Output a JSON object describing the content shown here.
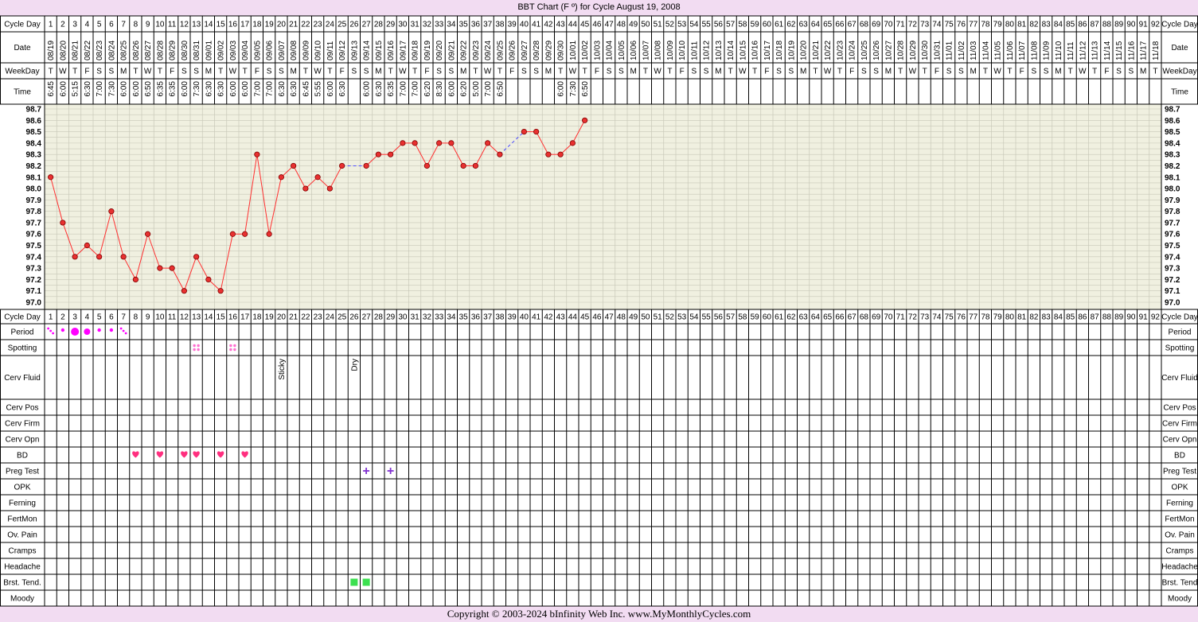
{
  "header": {
    "title": "BBT Chart (F º) for Cycle August 19, 2008"
  },
  "footer": {
    "copyright": "Copyright © 2003-2024 bInfinity Web Inc.     www.MyMonthlyCycles.com"
  },
  "row_labels": {
    "cycle_day": "Cycle Day",
    "date": "Date",
    "weekday": "WeekDay",
    "time": "Time",
    "period": "Period",
    "spotting": "Spotting",
    "cerv_fluid": "Cerv Fluid",
    "cerv_pos": "Cerv Pos",
    "cerv_firm": "Cerv Firm",
    "cerv_opn": "Cerv Opn",
    "bd": "BD",
    "preg_test": "Preg Test",
    "opk": "OPK",
    "ferning": "Ferning",
    "fertmon": "FertMon",
    "ov_pain": "Ov. Pain",
    "cramps": "Cramps",
    "headache": "Headache",
    "brst_tend_left": "Brst. Tend.",
    "brst_tend_right": "Brst. Tend",
    "moody": "Moody"
  },
  "colors": {
    "background": "#f2dcf2",
    "plot_background": "#f0f0e0",
    "grid": "#c8c8b8",
    "line": "#ff3030",
    "marker_fill": "#e83030",
    "dashed": "#5050ff",
    "period": "#ff00ff",
    "spotting": "#ff6fd0",
    "heart": "#ff2f7f",
    "preg_test": "#8030d0",
    "brst_tend": "#3ce050"
  },
  "chart_data": {
    "type": "line",
    "title": "BBT Chart (F º) for Cycle August 19, 2008",
    "ylim": [
      97.0,
      98.7
    ],
    "y_ticks": [
      "98.7",
      "98.6",
      "98.5",
      "98.4",
      "98.3",
      "98.2",
      "98.1",
      "98.0",
      "97.9",
      "97.8",
      "97.7",
      "97.6",
      "97.5",
      "97.4",
      "97.3",
      "97.2",
      "97.1",
      "97.0"
    ],
    "grid": true,
    "cycle_days": [
      1,
      2,
      3,
      4,
      5,
      6,
      7,
      8,
      9,
      10,
      11,
      12,
      13,
      14,
      15,
      16,
      17,
      18,
      19,
      20,
      21,
      22,
      23,
      24,
      25,
      26,
      27,
      28,
      29,
      30,
      31,
      32,
      33,
      34,
      35,
      36,
      37,
      38,
      39,
      40,
      41,
      42,
      43,
      44,
      45,
      46,
      47,
      48,
      49,
      50,
      51,
      52,
      53,
      54,
      55,
      56,
      57,
      58,
      59,
      60,
      61,
      62,
      63,
      64,
      65,
      66,
      67,
      68,
      69,
      70,
      71,
      72,
      73,
      74,
      75,
      76,
      77,
      78,
      79,
      80,
      81,
      82,
      83,
      84,
      85,
      86,
      87,
      88,
      89,
      90,
      91,
      92
    ],
    "dates": [
      "08/19",
      "08/20",
      "08/21",
      "08/22",
      "08/23",
      "08/24",
      "08/25",
      "08/26",
      "08/27",
      "08/28",
      "08/29",
      "08/30",
      "08/31",
      "09/01",
      "09/02",
      "09/03",
      "09/04",
      "09/05",
      "09/06",
      "09/07",
      "09/08",
      "09/09",
      "09/10",
      "09/11",
      "09/12",
      "09/13",
      "09/14",
      "09/15",
      "09/16",
      "09/17",
      "09/18",
      "09/19",
      "09/20",
      "09/21",
      "09/22",
      "09/23",
      "09/24",
      "09/25",
      "09/26",
      "09/27",
      "09/28",
      "09/29",
      "09/30",
      "10/01",
      "10/02",
      "10/03",
      "10/04",
      "10/05",
      "10/06",
      "10/07",
      "10/08",
      "10/09",
      "10/10",
      "10/11",
      "10/12",
      "10/13",
      "10/14",
      "10/15",
      "10/16",
      "10/17",
      "10/18",
      "10/19",
      "10/20",
      "10/21",
      "10/22",
      "10/23",
      "10/24",
      "10/25",
      "10/26",
      "10/27",
      "10/28",
      "10/29",
      "10/30",
      "10/31",
      "11/01",
      "11/02",
      "11/03",
      "11/04",
      "11/05",
      "11/06",
      "11/07",
      "11/08",
      "11/09",
      "11/10",
      "11/11",
      "11/12",
      "11/13",
      "11/14",
      "11/15",
      "11/16",
      "11/17",
      "11/18"
    ],
    "weekdays": [
      "T",
      "W",
      "T",
      "F",
      "S",
      "S",
      "M",
      "T",
      "W",
      "T",
      "F",
      "S",
      "S",
      "M",
      "T",
      "W",
      "T",
      "F",
      "S",
      "S",
      "M",
      "T",
      "W",
      "T",
      "F",
      "S",
      "S",
      "M",
      "T",
      "W",
      "T",
      "F",
      "S",
      "S",
      "M",
      "T",
      "W",
      "T",
      "F",
      "S",
      "S",
      "M",
      "T",
      "W",
      "T",
      "F",
      "S",
      "S",
      "M",
      "T",
      "W",
      "T",
      "F",
      "S",
      "S",
      "M",
      "T",
      "W",
      "T",
      "F",
      "S",
      "S",
      "M",
      "T",
      "W",
      "T",
      "F",
      "S",
      "S",
      "M",
      "T",
      "W",
      "T",
      "F",
      "S",
      "S",
      "M",
      "T",
      "W",
      "T",
      "F",
      "S",
      "S",
      "M",
      "T",
      "W",
      "T",
      "F",
      "S",
      "S",
      "M",
      "T"
    ],
    "times": [
      "6:45",
      "6:00",
      "5:15",
      "6:30",
      "7:00",
      "7:30",
      "6:00",
      "6:00",
      "6:50",
      "6:35",
      "6:35",
      "6:00",
      "7:30",
      "6:30",
      "6:30",
      "6:00",
      "6:00",
      "7:00",
      "7:00",
      "6:30",
      "6:30",
      "6:45",
      "5:55",
      "6:00",
      "6:30",
      "",
      "6:00",
      "6:30",
      "6:35",
      "7:00",
      "7:00",
      "6:20",
      "8:30",
      "6:00",
      "6:20",
      "5:00",
      "7:00",
      "6:50",
      "",
      "",
      "",
      "",
      "6:00",
      "7:30",
      "6:50"
    ],
    "temps": [
      98.1,
      97.7,
      97.4,
      97.5,
      97.4,
      97.8,
      97.4,
      97.2,
      97.6,
      97.3,
      97.3,
      97.1,
      97.4,
      97.2,
      97.1,
      97.6,
      97.6,
      98.3,
      97.6,
      98.1,
      98.2,
      98.0,
      98.1,
      98.0,
      98.2,
      null,
      98.2,
      98.3,
      98.3,
      98.4,
      98.4,
      98.2,
      98.4,
      98.4,
      98.2,
      98.2,
      98.4,
      98.3,
      null,
      98.5,
      98.5,
      98.3,
      98.3,
      98.4,
      98.6
    ],
    "period": {
      "3": "heavy",
      "4": "medium",
      "1": "spotty",
      "2": "light",
      "5": "light",
      "6": "light",
      "7": "spotty"
    },
    "spotting_days": [
      13,
      16
    ],
    "cerv_fluid": {
      "20": "Sticky",
      "26": "Dry"
    },
    "bd_days": [
      8,
      10,
      12,
      13,
      15,
      17
    ],
    "preg_test_days": [
      27,
      29
    ],
    "brst_tend_days": [
      26,
      27
    ]
  }
}
